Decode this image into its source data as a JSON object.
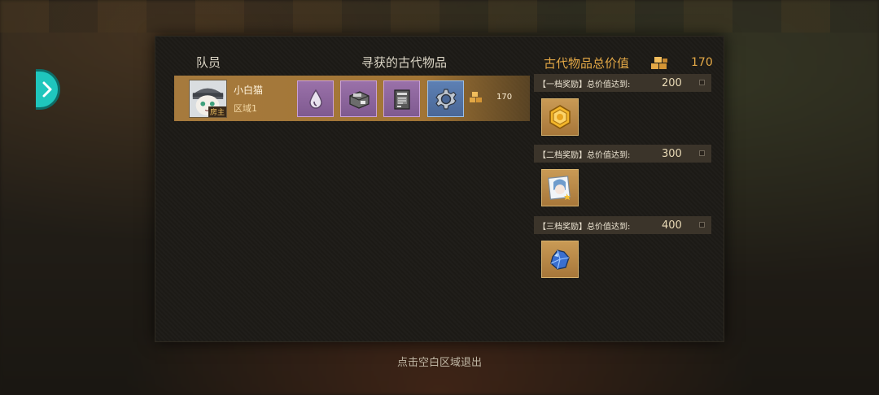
{
  "headers": {
    "member": "队员",
    "items": "寻获的古代物品",
    "total_label": "古代物品总价值",
    "total_value": "170"
  },
  "member": {
    "name": "小白猫",
    "zone": "区域1",
    "tag": "房主",
    "items": [
      {
        "icon": "water-drop-icon",
        "rarity": "purple"
      },
      {
        "icon": "machine-block-icon",
        "rarity": "purple"
      },
      {
        "icon": "circuit-panel-icon",
        "rarity": "purple"
      },
      {
        "icon": "gear-icon",
        "rarity": "blue"
      }
    ],
    "value": "170"
  },
  "tiers": [
    {
      "label": "【一档奖励】总价值达到:",
      "value": "200",
      "reward_icon": "gold-coin-icon"
    },
    {
      "label": "【二档奖励】总价值达到:",
      "value": "300",
      "reward_icon": "character-portrait-icon"
    },
    {
      "label": "【三档奖励】总价值达到:",
      "value": "400",
      "reward_icon": "blue-crystal-icon"
    }
  ],
  "exit_hint": "点击空白区域退出",
  "colors": {
    "accent": "#e3a846",
    "row": "#a67a3d",
    "side_button": "#1fc6bd"
  }
}
